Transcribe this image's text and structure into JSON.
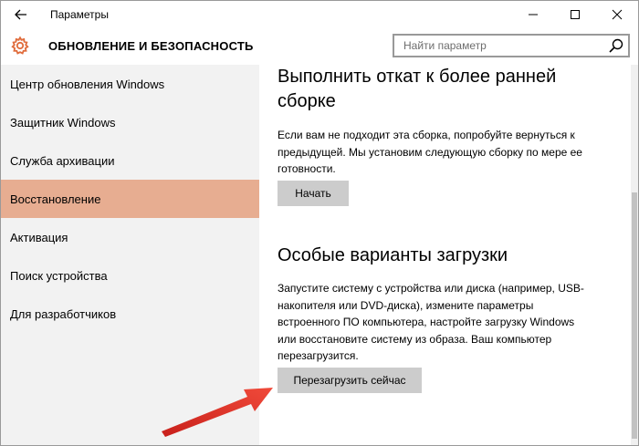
{
  "window": {
    "title": "Параметры"
  },
  "header": {
    "section_title": "ОБНОВЛЕНИЕ И БЕЗОПАСНОСТЬ",
    "search_placeholder": "Найти параметр"
  },
  "sidebar": {
    "items": [
      {
        "label": "Центр обновления Windows",
        "selected": false
      },
      {
        "label": "Защитник Windows",
        "selected": false
      },
      {
        "label": "Служба архивации",
        "selected": false
      },
      {
        "label": "Восстановление",
        "selected": true
      },
      {
        "label": "Активация",
        "selected": false
      },
      {
        "label": "Поиск устройства",
        "selected": false
      },
      {
        "label": "Для разработчиков",
        "selected": false
      }
    ]
  },
  "main": {
    "rollback": {
      "heading_line1": "Выполнить откат к более ранней",
      "heading_line2": "сборке",
      "text_line1": "Если вам не подходит эта сборка, попробуйте вернуться к",
      "text_line2": "предыдущей. Мы установим следующую сборку по мере ее",
      "text_line3": "готовности.",
      "button_label": "Начать"
    },
    "advanced": {
      "heading": "Особые варианты загрузки",
      "text_line1": "Запустите систему с устройства или диска (например, USB-",
      "text_line2": "накопителя или DVD-диска), измените параметры",
      "text_line3": "встроенного ПО компьютера, настройте загрузку Windows",
      "text_line4": "или восстановите систему из образа. Ваш компьютер",
      "text_line5": "перезагрузится.",
      "button_label": "Перезагрузить сейчас"
    }
  },
  "colors": {
    "selected_nav": "#e7ad91",
    "accent_gear": "#e06c3c",
    "annotation_arrow": "#e8392f"
  }
}
